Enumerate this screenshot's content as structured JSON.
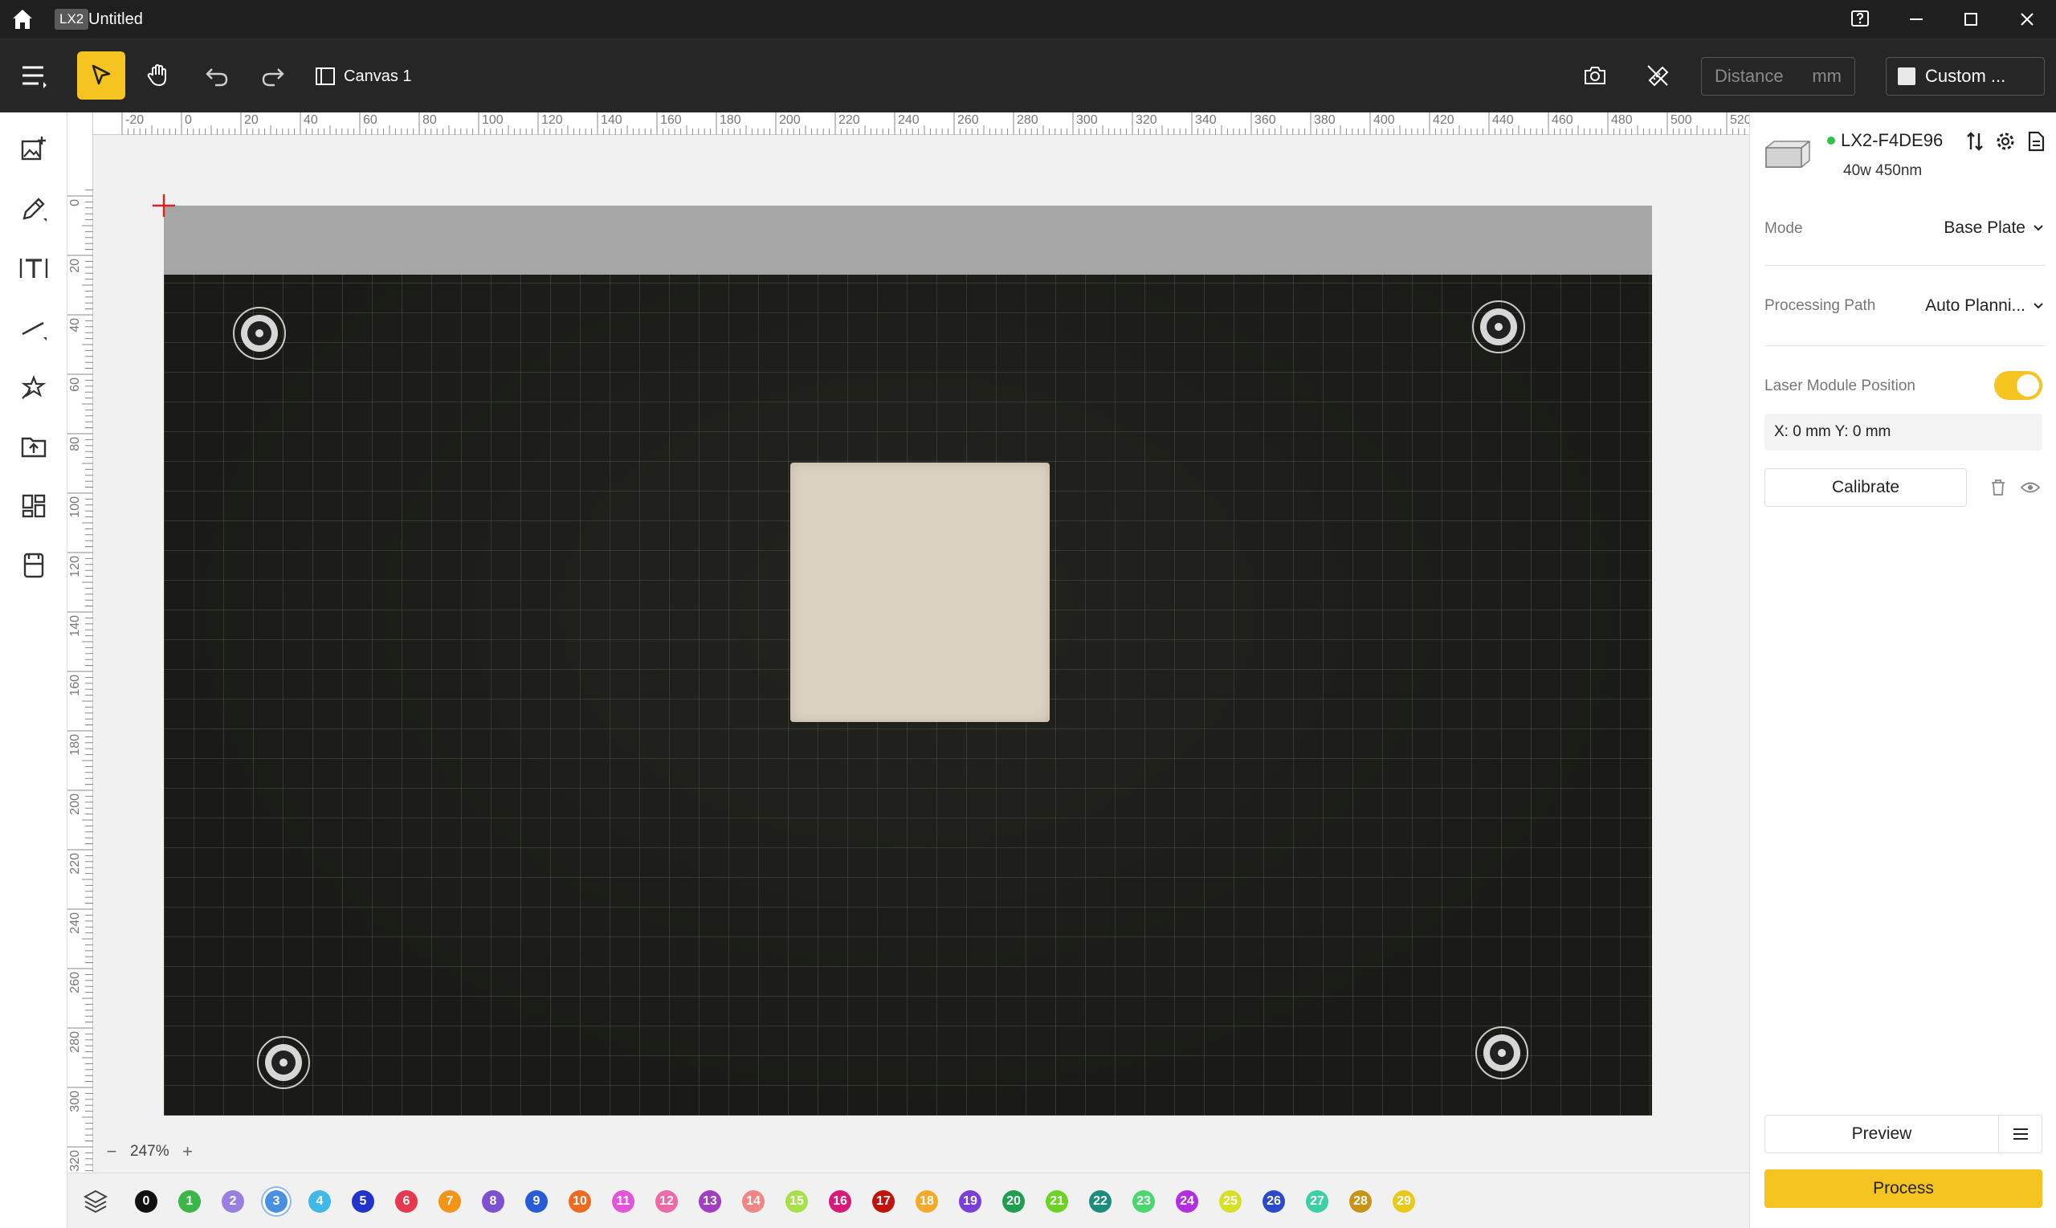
{
  "titlebar": {
    "badge": "LX2",
    "title": "Untitled"
  },
  "toolbar": {
    "canvas_tab": "Canvas 1",
    "distance_placeholder": "Distance",
    "distance_unit": "mm",
    "custom_label": "Custom ..."
  },
  "ruler_top": [
    "-20",
    "0",
    "20",
    "40",
    "60",
    "80",
    "100",
    "120",
    "140",
    "160",
    "180",
    "200",
    "220",
    "240",
    "260",
    "280",
    "300",
    "320",
    "340",
    "360",
    "380",
    "400",
    "420",
    "440",
    "460",
    "480",
    "500",
    "520"
  ],
  "ruler_left": [
    "0",
    "20",
    "40",
    "60",
    "80",
    "100",
    "120",
    "140",
    "160",
    "180",
    "200",
    "220",
    "240",
    "260",
    "280",
    "300",
    "320"
  ],
  "zoom": {
    "value": "247%"
  },
  "layers": [
    {
      "n": "0",
      "color": "#111111"
    },
    {
      "n": "1",
      "color": "#3cb54a"
    },
    {
      "n": "2",
      "color": "#9b7fe0"
    },
    {
      "n": "3",
      "color": "#4a90e2",
      "selected": true
    },
    {
      "n": "4",
      "color": "#3fb9e8"
    },
    {
      "n": "5",
      "color": "#2233cc"
    },
    {
      "n": "6",
      "color": "#e8384f"
    },
    {
      "n": "7",
      "color": "#f29418"
    },
    {
      "n": "8",
      "color": "#7d4fd1"
    },
    {
      "n": "9",
      "color": "#2a5bd7"
    },
    {
      "n": "10",
      "color": "#f06a1d"
    },
    {
      "n": "11",
      "color": "#e254d8"
    },
    {
      "n": "12",
      "color": "#ee6aa6"
    },
    {
      "n": "13",
      "color": "#a23ec2"
    },
    {
      "n": "14",
      "color": "#f08585"
    },
    {
      "n": "15",
      "color": "#a8e04c"
    },
    {
      "n": "16",
      "color": "#d81b7a"
    },
    {
      "n": "17",
      "color": "#c0150f"
    },
    {
      "n": "18",
      "color": "#f6a828"
    },
    {
      "n": "19",
      "color": "#7a3fd8"
    },
    {
      "n": "20",
      "color": "#1e9e4e"
    },
    {
      "n": "21",
      "color": "#6cd326"
    },
    {
      "n": "22",
      "color": "#1c8c7c"
    },
    {
      "n": "23",
      "color": "#4cd66e"
    },
    {
      "n": "24",
      "color": "#b22ee0"
    },
    {
      "n": "25",
      "color": "#d6e026"
    },
    {
      "n": "26",
      "color": "#2c49c9"
    },
    {
      "n": "27",
      "color": "#3cd0a4"
    },
    {
      "n": "28",
      "color": "#c99316"
    },
    {
      "n": "29",
      "color": "#e8c91a"
    }
  ],
  "device": {
    "name": "LX2-F4DE96",
    "sub": "40w 450nm"
  },
  "panel": {
    "mode_label": "Mode",
    "mode_value": "Base Plate",
    "path_label": "Processing Path",
    "path_value": "Auto Planni...",
    "laser_label": "Laser Module Position",
    "coords": "X: 0 mm  Y: 0 mm",
    "calibrate": "Calibrate",
    "preview": "Preview",
    "process": "Process"
  },
  "colors": {
    "accent": "#f6c421",
    "titlebar": "#1f1f1f",
    "toolbar": "#262626"
  }
}
